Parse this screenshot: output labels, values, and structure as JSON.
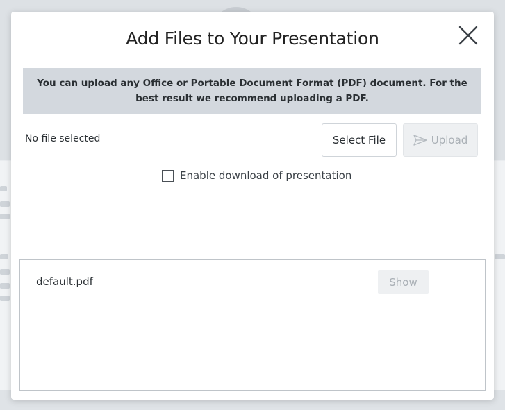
{
  "dialog": {
    "title": "Add Files to Your Presentation",
    "info_message": "You can upload any Office or Portable Document Format (PDF) document.  For the best result we recommend uploading a PDF.",
    "status": "No file selected",
    "select_file_label": "Select File",
    "upload_label": "Upload",
    "upload_icon": "send-icon",
    "close_icon": "close-icon",
    "enable_download_label": "Enable download of presentation",
    "enable_download_checked": false
  },
  "files": [
    {
      "name": "default.pdf",
      "action_label": "Show"
    }
  ],
  "colors": {
    "banner_bg": "#d3d8de",
    "disabled_bg": "#eef0f2",
    "disabled_text": "#a9afb5",
    "text": "#2a2f33"
  }
}
